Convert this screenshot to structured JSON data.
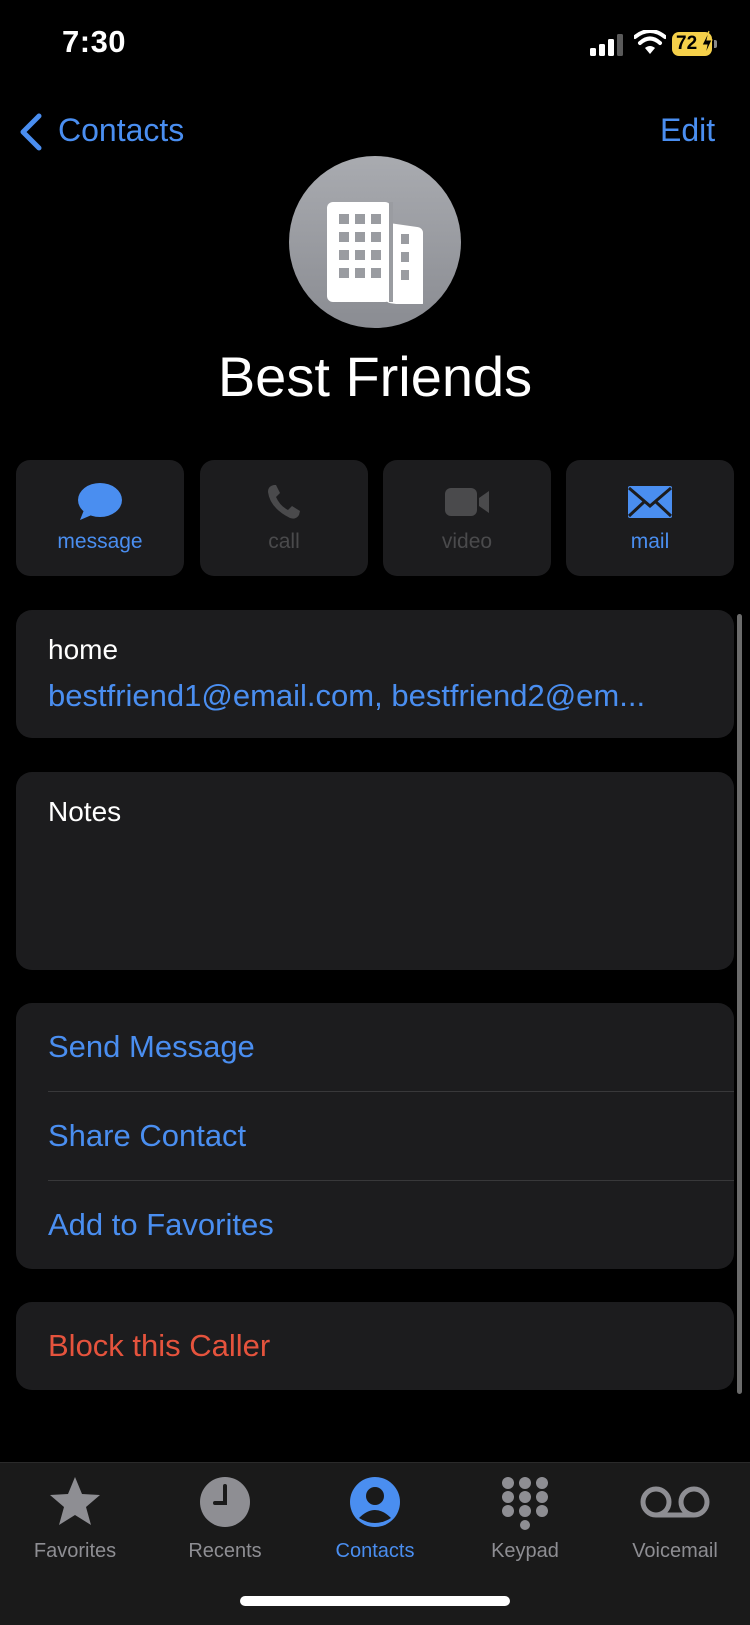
{
  "status_bar": {
    "time": "7:30",
    "battery": "72"
  },
  "nav": {
    "back_label": "Contacts",
    "edit_label": "Edit"
  },
  "contact": {
    "name": "Best Friends"
  },
  "actions": [
    {
      "label": "message",
      "icon": "message-bubble-icon",
      "enabled": true
    },
    {
      "label": "call",
      "icon": "phone-icon",
      "enabled": false
    },
    {
      "label": "video",
      "icon": "video-camera-icon",
      "enabled": false
    },
    {
      "label": "mail",
      "icon": "envelope-icon",
      "enabled": true
    }
  ],
  "email": {
    "label": "home",
    "value": "bestfriend1@email.com, bestfriend2@em..."
  },
  "notes": {
    "label": "Notes"
  },
  "options": [
    {
      "label": "Send Message"
    },
    {
      "label": "Share Contact"
    },
    {
      "label": "Add to Favorites"
    }
  ],
  "block": {
    "label": "Block this Caller"
  },
  "tabs": [
    {
      "label": "Favorites",
      "icon": "star-icon"
    },
    {
      "label": "Recents",
      "icon": "clock-icon"
    },
    {
      "label": "Contacts",
      "icon": "person-circle-icon",
      "active": true
    },
    {
      "label": "Keypad",
      "icon": "keypad-icon"
    },
    {
      "label": "Voicemail",
      "icon": "voicemail-icon"
    }
  ],
  "colors": {
    "accent": "#4a8ef0",
    "destructive": "#e5533d",
    "card": "#1c1c1e",
    "battery": "#f5d04a"
  }
}
